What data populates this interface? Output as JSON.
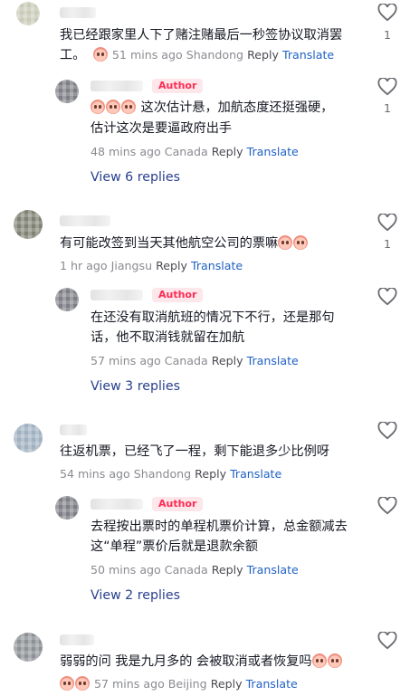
{
  "comments": [
    {
      "text_lines": [
        "我已经跟家里人下了赌注赌最后一秒签协议取消罢",
        "工。"
      ],
      "ago": "51 mins ago",
      "region": "Shandong",
      "reply_label": "Reply",
      "translate_label": "Translate",
      "likes": "1",
      "reply": {
        "author_badge": "Author",
        "text_lines": [
          "这次估计悬，加航态度还挺强硬，",
          "估计这次是要逼政府出手"
        ],
        "ago": "48 mins ago",
        "region": "Canada",
        "reply_label": "Reply",
        "translate_label": "Translate",
        "likes": "1"
      },
      "view_replies": "View 6 replies"
    },
    {
      "text_lines": [
        "有可能改签到当天其他航空公司的票嘛"
      ],
      "ago": "1 hr ago",
      "region": "Jiangsu",
      "reply_label": "Reply",
      "translate_label": "Translate",
      "likes": "1",
      "reply": {
        "author_badge": "Author",
        "text_lines": [
          "在还没有取消航班的情况下不行，还是那句",
          "话，他不取消钱就留在加航"
        ],
        "ago": "57 mins ago",
        "region": "Canada",
        "reply_label": "Reply",
        "translate_label": "Translate",
        "likes": ""
      },
      "view_replies": "View 3 replies"
    },
    {
      "text_lines": [
        "往返机票，已经飞了一程，剩下能退多少比例呀"
      ],
      "ago": "54 mins ago",
      "region": "Shandong",
      "reply_label": "Reply",
      "translate_label": "Translate",
      "likes": "",
      "reply": {
        "author_badge": "Author",
        "text_lines": [
          "去程按出票时的单程机票价计算，总金额减去",
          "这“单程”票价后就是退款余额"
        ],
        "ago": "50 mins ago",
        "region": "Canada",
        "reply_label": "Reply",
        "translate_label": "Translate",
        "likes": ""
      },
      "view_replies": "View 2 replies"
    },
    {
      "text_lines": [
        "弱弱的问 我是九月多的 会被取消或者恢复吗"
      ],
      "ago": "57 mins ago",
      "region": "Beijing",
      "reply_label": "Reply",
      "translate_label": "Translate",
      "likes": ""
    }
  ]
}
